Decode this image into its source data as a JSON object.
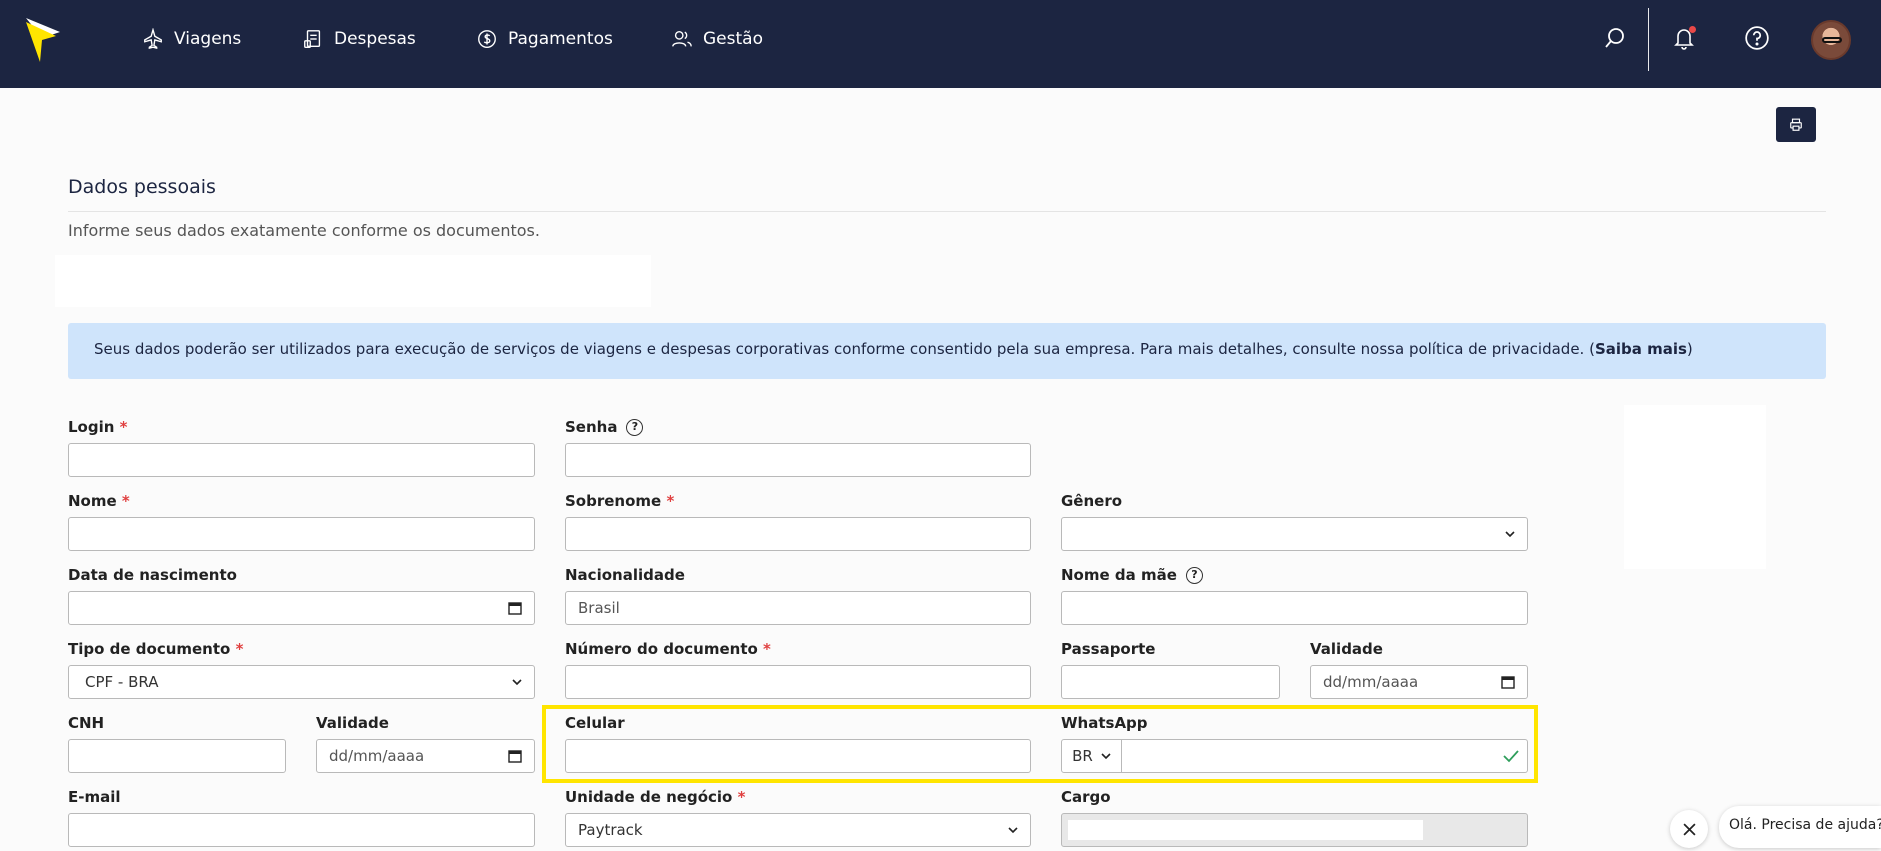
{
  "nav": {
    "items": [
      {
        "label": "Viagens",
        "icon": "plane-icon"
      },
      {
        "label": "Despesas",
        "icon": "receipt-icon"
      },
      {
        "label": "Pagamentos",
        "icon": "dollar-coin-icon"
      },
      {
        "label": "Gestão",
        "icon": "users-icon"
      }
    ],
    "brand_color": "#1c2541",
    "logo_color": "#ffe500"
  },
  "page": {
    "title": "Dados pessoais",
    "subtitle": "Informe seus dados exatamente conforme os documentos.",
    "banner_text": "Seus dados poderão ser utilizados para execução de serviços de viagens e despesas corporativas conforme consentido pela sua empresa. Para mais detalhes, consulte nossa política de privacidade. (",
    "banner_link": "Saiba mais",
    "banner_end": ")"
  },
  "form": {
    "login": {
      "label": "Login",
      "required": "*",
      "value": ""
    },
    "senha": {
      "label": "Senha",
      "help": "?",
      "value": ""
    },
    "nome": {
      "label": "Nome",
      "required": "*",
      "value": ""
    },
    "sobrenome": {
      "label": "Sobrenome",
      "required": "*",
      "value": ""
    },
    "genero": {
      "label": "Gênero",
      "value": ""
    },
    "data_nascimento": {
      "label": "Data de nascimento",
      "value": ""
    },
    "nacionalidade": {
      "label": "Nacionalidade",
      "value": "Brasil"
    },
    "nome_mae": {
      "label": "Nome da mãe",
      "help": "?",
      "value": ""
    },
    "tipo_documento": {
      "label": "Tipo de documento",
      "required": "*",
      "value": "CPF - BRA"
    },
    "numero_documento": {
      "label": "Número do documento",
      "required": "*",
      "value": ""
    },
    "passaporte": {
      "label": "Passaporte",
      "value": ""
    },
    "validade_passaporte": {
      "label": "Validade",
      "value": "dd/mm/aaaa"
    },
    "cnh": {
      "label": "CNH",
      "value": ""
    },
    "validade_cnh": {
      "label": "Validade",
      "value": "dd/mm/aaaa"
    },
    "celular": {
      "label": "Celular",
      "value": ""
    },
    "whatsapp": {
      "label": "WhatsApp",
      "country": "BR",
      "value": ""
    },
    "email": {
      "label": "E-mail",
      "value": ""
    },
    "unidade_negocio": {
      "label": "Unidade de negócio",
      "required": "*",
      "value": "Paytrack"
    },
    "cargo": {
      "label": "Cargo",
      "value": ""
    }
  },
  "chat": {
    "prompt": "Olá. Precisa de ajuda?"
  },
  "accent": {
    "highlight": "#ffe500",
    "required": "#e04040",
    "banner_bg": "#cfe4fb",
    "valid_check": "#2e9e5b"
  }
}
